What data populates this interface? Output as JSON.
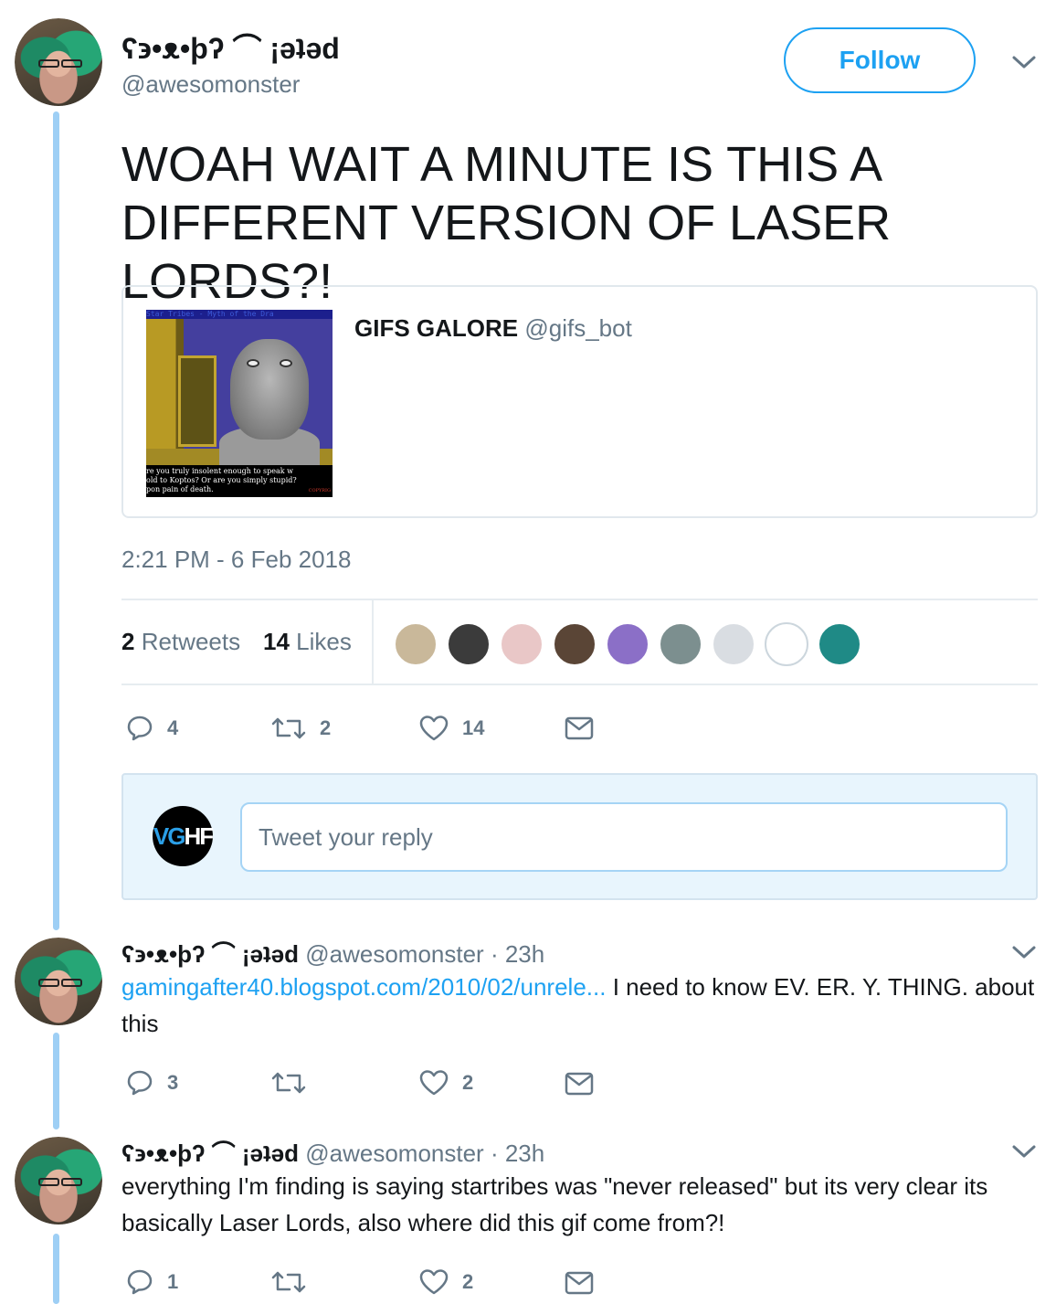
{
  "main_tweet": {
    "display_name": "ʕ϶•ᴥ•ϸʔ ⌒ ¡ǝʇǝd",
    "handle": "@awesomonster",
    "follow_label": "Follow",
    "text": "WOAH WAIT A MINUTE IS THIS A DIFFERENT VERSION OF LASER LORDS?!",
    "quote": {
      "author_name": "GIFS GALORE",
      "author_handle": "@gifs_bot",
      "image": {
        "top_text": "Star Tribes - Myth of the Dra",
        "caption_lines": [
          "re you truly insolent enough to speak w",
          "old to Koptos? Or are you simply stupid?",
          "pon pain of death."
        ],
        "copyright": "COPYRIG"
      }
    },
    "timestamp": "2:21 PM - 6 Feb 2018",
    "stats": {
      "retweets_count": "2",
      "retweets_label": "Retweets",
      "likes_count": "14",
      "likes_label": "Likes"
    },
    "likers_colors": [
      "#c9b89a",
      "#3b3b3b",
      "#e9c7c7",
      "#5a4536",
      "#8b6fc7",
      "#7c8f8f",
      "#d9dde2",
      "#ffffff",
      "#1f8a86"
    ],
    "actions": {
      "replies": "4",
      "retweets": "2",
      "likes": "14"
    }
  },
  "reply_composer": {
    "avatar_text_v": "VG",
    "avatar_text_rest": "HF",
    "placeholder": "Tweet your reply"
  },
  "replies": [
    {
      "display_name": "ʕ϶•ᴥ•ϸʔ ⌒ ¡ǝʇǝd",
      "handle": "@awesomonster",
      "time": "· 23h",
      "link": "gamingafter40.blogspot.com/2010/02/unrele...",
      "text": " I need to know EV. ER. Y. THING. about this",
      "actions": {
        "replies": "3",
        "retweets": "",
        "likes": "2"
      }
    },
    {
      "display_name": "ʕ϶•ᴥ•ϸʔ ⌒ ¡ǝʇǝd",
      "handle": "@awesomonster",
      "time": "· 23h",
      "link": "",
      "text": "everything I'm finding is saying startribes was \"never released\" but its very clear its basically Laser Lords, also where did this gif come from?!",
      "actions": {
        "replies": "1",
        "retweets": "",
        "likes": "2"
      }
    }
  ]
}
